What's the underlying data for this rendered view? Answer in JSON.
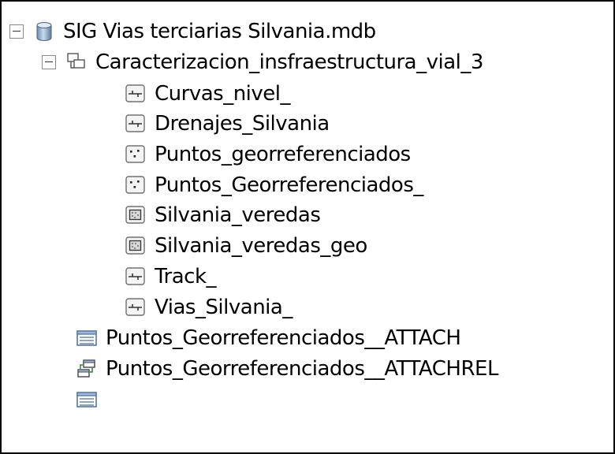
{
  "tree": {
    "database": {
      "label": "SIG Vias terciarias Silvania.mdb",
      "icon": "database-icon",
      "expanded": true
    },
    "dataset": {
      "label": "Caracterizacion_insfraestructura_vial_3",
      "icon": "feature-dataset-icon",
      "expanded": true
    },
    "feature_classes": [
      {
        "label": "Curvas_nivel_",
        "icon": "line-feature-class-icon"
      },
      {
        "label": "Drenajes_Silvania",
        "icon": "line-feature-class-icon"
      },
      {
        "label": "Puntos_georreferenciados",
        "icon": "point-feature-class-icon"
      },
      {
        "label": "Puntos_Georreferenciados_",
        "icon": "point-feature-class-icon"
      },
      {
        "label": "Silvania_veredas",
        "icon": "polygon-feature-class-icon"
      },
      {
        "label": "Silvania_veredas_geo",
        "icon": "polygon-feature-class-icon"
      },
      {
        "label": "Track_",
        "icon": "line-feature-class-icon"
      },
      {
        "label": "Vias_Silvania_",
        "icon": "line-feature-class-icon"
      }
    ],
    "tables": [
      {
        "label": "Puntos_Georreferenciados__ATTACH",
        "icon": "table-icon"
      },
      {
        "label": "Puntos_Georreferenciados__ATTACHREL",
        "icon": "relationship-class-icon"
      },
      {
        "label": "",
        "icon": "table-icon"
      }
    ]
  }
}
